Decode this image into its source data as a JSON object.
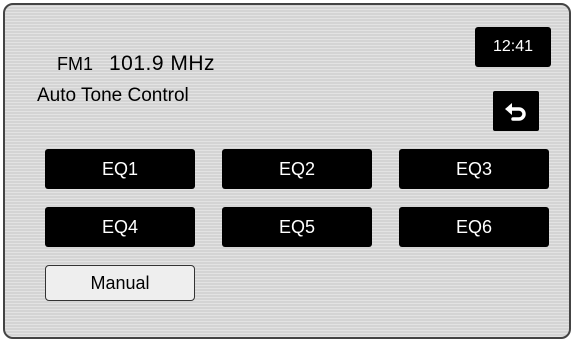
{
  "header": {
    "band": "FM1",
    "frequency": "101.9 MHz",
    "subtitle": "Auto Tone Control",
    "clock": "12:41"
  },
  "back_button": {
    "icon": "back-arrow-icon"
  },
  "presets": [
    {
      "label": "EQ1"
    },
    {
      "label": "EQ2"
    },
    {
      "label": "EQ3"
    },
    {
      "label": "EQ4"
    },
    {
      "label": "EQ5"
    },
    {
      "label": "EQ6"
    }
  ],
  "manual_button": {
    "label": "Manual"
  },
  "colors": {
    "button_bg": "#000000",
    "button_text": "#ffffff",
    "screen_bg": "#d4d4d4"
  }
}
